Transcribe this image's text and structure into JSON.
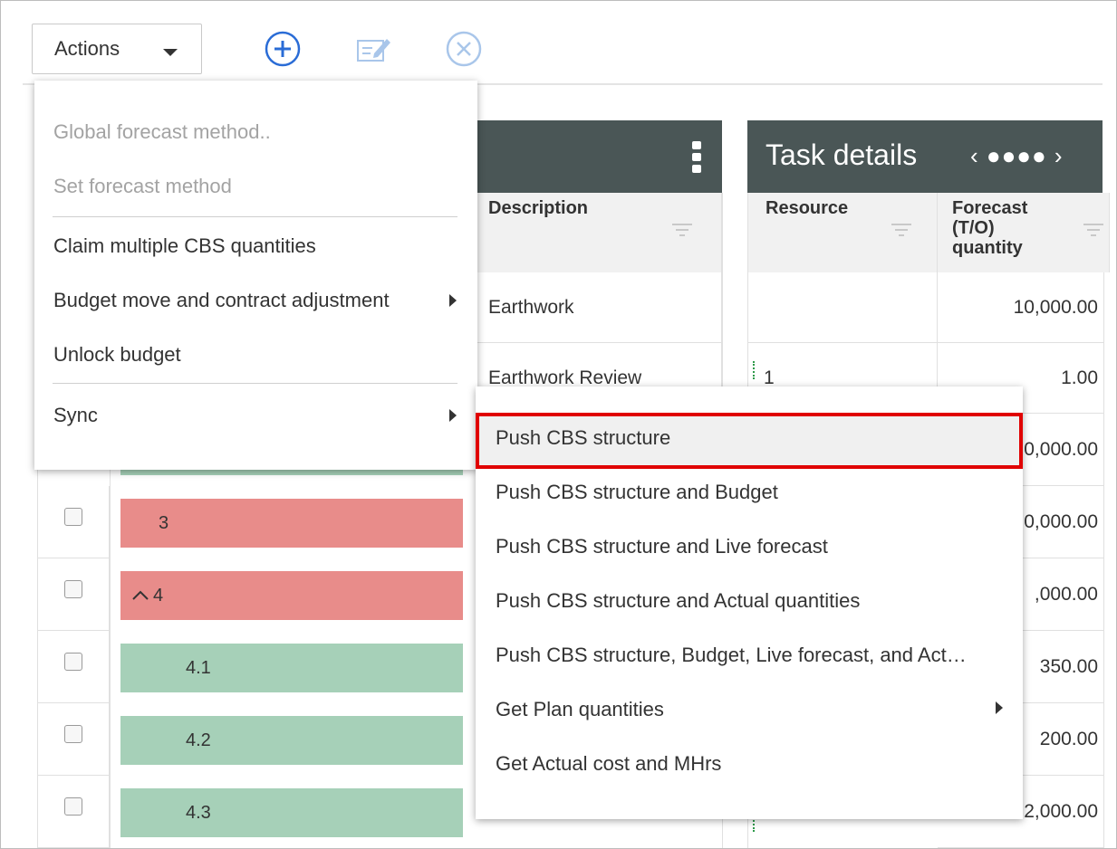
{
  "toolbar": {
    "actions_label": "Actions",
    "icons": [
      "add-circle-icon",
      "edit-note-icon",
      "cancel-circle-icon"
    ]
  },
  "panel": {
    "task_details_title": "Task details",
    "pager": "‹ ●●●● ›",
    "more_icon": "kebab-menu-icon"
  },
  "columns": {
    "description": "Description",
    "resource": "Resource",
    "forecast": "Forecast (T/O) quantity"
  },
  "rows": [
    {
      "description": "Earthwork",
      "resource": "",
      "forecast": "10,000.00"
    },
    {
      "description": "Earthwork Review",
      "resource": "1",
      "forecast": "1.00"
    },
    {
      "description": "",
      "resource": "",
      "forecast": "0,000.00"
    },
    {
      "description": "",
      "resource": "",
      "forecast": "0,000.00"
    },
    {
      "description": "",
      "resource": "",
      "forecast": ",000.00"
    },
    {
      "description": "",
      "resource": "",
      "forecast": "350.00"
    },
    {
      "description": "",
      "resource": "",
      "forecast": "200.00"
    },
    {
      "description": "",
      "resource": "",
      "forecast": "2,000.00"
    }
  ],
  "cbs_rows": [
    {
      "code": "3",
      "status": "red"
    },
    {
      "code": "4",
      "status": "red",
      "expanded": true
    },
    {
      "code": "4.1",
      "status": "green"
    },
    {
      "code": "4.2",
      "status": "green"
    },
    {
      "code": "4.3",
      "status": "green"
    }
  ],
  "actions_menu": {
    "items": [
      {
        "label": "Global forecast method..",
        "disabled": true
      },
      {
        "label": "Set forecast method",
        "disabled": true
      },
      {
        "label": "Claim multiple CBS quantities",
        "disabled": false
      },
      {
        "label": "Budget move and contract adjustment",
        "disabled": false,
        "submenu": true
      },
      {
        "label": "Unlock budget",
        "disabled": false
      },
      {
        "label": "Sync",
        "disabled": false,
        "submenu": true
      }
    ]
  },
  "sync_menu": {
    "items": [
      {
        "label": "Push CBS structure",
        "highlighted": true
      },
      {
        "label": "Push CBS structure and Budget"
      },
      {
        "label": "Push CBS structure and Live forecast"
      },
      {
        "label": "Push CBS structure and Actual quantities"
      },
      {
        "label": "Push CBS structure, Budget, Live forecast, and Act…"
      },
      {
        "label": "Get Plan quantities",
        "submenu": true
      },
      {
        "label": "Get Actual cost and MHrs"
      }
    ]
  },
  "colors": {
    "header_dark": "#4a5656",
    "status_green": "#a6d0b8",
    "status_red": "#e88c8a",
    "highlight_border": "#e00000",
    "accent_blue": "#2a6cd6"
  }
}
